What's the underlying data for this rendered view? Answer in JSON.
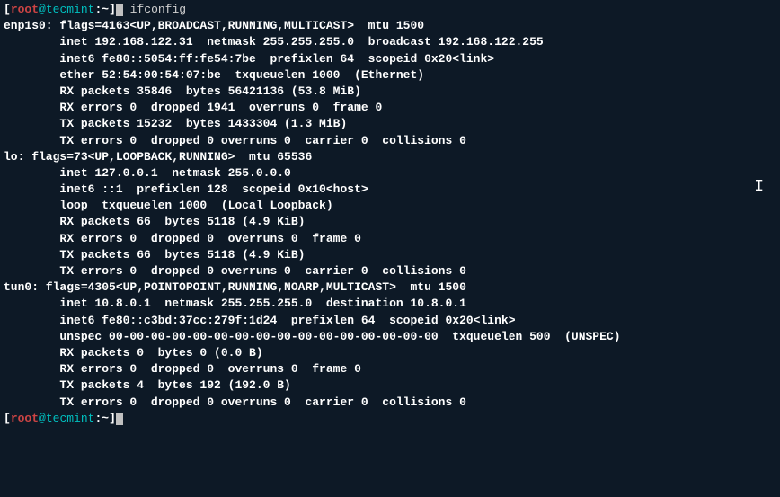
{
  "prompt1": {
    "bracket_open": "[",
    "user": "root",
    "at": "@",
    "host": "tecmint",
    "path": ":~",
    "bracket_close": "]",
    "command": " ifconfig"
  },
  "iface1": {
    "header": "enp1s0: flags=4163<UP,BROADCAST,RUNNING,MULTICAST>  mtu 1500",
    "inet": "        inet 192.168.122.31  netmask 255.255.255.0  broadcast 192.168.122.255",
    "inet6": "        inet6 fe80::5054:ff:fe54:7be  prefixlen 64  scopeid 0x20<link>",
    "ether": "        ether 52:54:00:54:07:be  txqueuelen 1000  (Ethernet)",
    "rxp": "        RX packets 35846  bytes 56421136 (53.8 MiB)",
    "rxe": "        RX errors 0  dropped 1941  overruns 0  frame 0",
    "txp": "        TX packets 15232  bytes 1433304 (1.3 MiB)",
    "txe": "        TX errors 0  dropped 0 overruns 0  carrier 0  collisions 0"
  },
  "iface2": {
    "header": "lo: flags=73<UP,LOOPBACK,RUNNING>  mtu 65536",
    "inet": "        inet 127.0.0.1  netmask 255.0.0.0",
    "inet6": "        inet6 ::1  prefixlen 128  scopeid 0x10<host>",
    "loop": "        loop  txqueuelen 1000  (Local Loopback)",
    "rxp": "        RX packets 66  bytes 5118 (4.9 KiB)",
    "rxe": "        RX errors 0  dropped 0  overruns 0  frame 0",
    "txp": "        TX packets 66  bytes 5118 (4.9 KiB)",
    "txe": "        TX errors 0  dropped 0 overruns 0  carrier 0  collisions 0"
  },
  "iface3": {
    "header": "tun0: flags=4305<UP,POINTOPOINT,RUNNING,NOARP,MULTICAST>  mtu 1500",
    "inet": "        inet 10.8.0.1  netmask 255.255.255.0  destination 10.8.0.1",
    "inet6": "        inet6 fe80::c3bd:37cc:279f:1d24  prefixlen 64  scopeid 0x20<link>",
    "unspec": "        unspec 00-00-00-00-00-00-00-00-00-00-00-00-00-00-00-00  txqueuelen 500  (UNSPEC)",
    "rxp": "        RX packets 0  bytes 0 (0.0 B)",
    "rxe": "        RX errors 0  dropped 0  overruns 0  frame 0",
    "txp": "        TX packets 4  bytes 192 (192.0 B)",
    "txe": "        TX errors 0  dropped 0 overruns 0  carrier 0  collisions 0"
  },
  "prompt2": {
    "bracket_open": "[",
    "user": "root",
    "at": "@",
    "host": "tecmint",
    "path": ":~",
    "bracket_close": "]"
  },
  "empty": ""
}
